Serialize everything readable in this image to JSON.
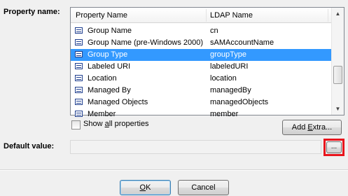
{
  "labels": {
    "property_name": "Property name:",
    "default_value": "Default value:"
  },
  "list": {
    "columns": [
      "Property Name",
      "LDAP Name"
    ],
    "rows": [
      {
        "name": "",
        "ldap": ""
      },
      {
        "name": "Group Name",
        "ldap": "cn"
      },
      {
        "name": "Group Name (pre-Windows 2000)",
        "ldap": "sAMAccountName"
      },
      {
        "name": "Group Type",
        "ldap": "groupType",
        "selected": true
      },
      {
        "name": "Labeled URI",
        "ldap": "labeledURI"
      },
      {
        "name": "Location",
        "ldap": "location"
      },
      {
        "name": "Managed By",
        "ldap": "managedBy"
      },
      {
        "name": "Managed Objects",
        "ldap": "managedObjects"
      },
      {
        "name": "Member",
        "ldap": "member"
      }
    ]
  },
  "show_all": {
    "label_pre": "Show ",
    "label_acc": "a",
    "label_post": "ll properties",
    "checked": false
  },
  "buttons": {
    "add_extra_pre": "Add ",
    "add_extra_acc": "E",
    "add_extra_post": "xtra...",
    "browse": "...",
    "ok_acc": "O",
    "ok_post": "K",
    "cancel": "Cancel"
  },
  "default_value": {
    "value": ""
  },
  "colors": {
    "selection": "#3399ff",
    "highlight_box": "#e8141c"
  }
}
